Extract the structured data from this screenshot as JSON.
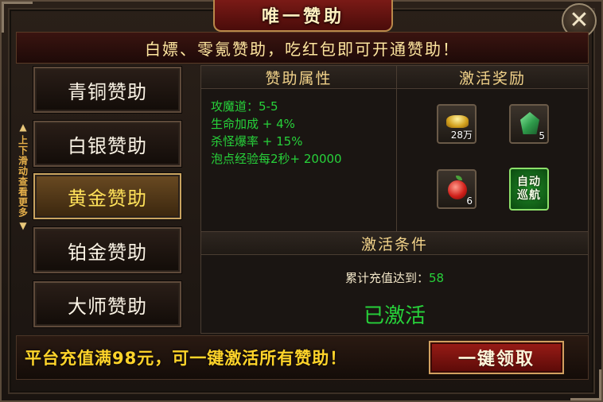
{
  "window": {
    "title": "唯一赞助",
    "close_symbol": "✕",
    "close_icon": "close-icon"
  },
  "banner": {
    "text": "白嫖、零氪赞助，吃红包即可开通赞助！"
  },
  "tiers": {
    "items": [
      {
        "label": "青铜赞助",
        "active": false
      },
      {
        "label": "白银赞助",
        "active": false
      },
      {
        "label": "黄金赞助",
        "active": true
      },
      {
        "label": "铂金赞助",
        "active": false
      },
      {
        "label": "大师赞助",
        "active": false
      }
    ],
    "scroll_hint": "上下滑动查看更多",
    "scroll_up_symbol": "▲",
    "scroll_down_symbol": "▼"
  },
  "attributes": {
    "title": "赞助属性",
    "lines": [
      "攻魔道：5-5",
      "生命加成 + 4%",
      "杀怪爆率 + 15%",
      "泡点经验每2秒+ 20000"
    ]
  },
  "rewards": {
    "title": "激活奖励",
    "items": [
      {
        "icon": "gold-ingot-icon",
        "qty": "28万"
      },
      {
        "icon": "jade-icon",
        "qty": "5"
      },
      {
        "icon": "apple-icon",
        "qty": "6"
      }
    ],
    "auto_cruise": {
      "line1": "自动",
      "line2": "巡航"
    }
  },
  "conditions": {
    "title": "激活条件",
    "label": "累计充值达到：",
    "value": "58",
    "status": "已激活"
  },
  "bottom": {
    "text": "平台充值满98元，可一键激活所有赞助！",
    "claim_label": "一键领取"
  },
  "colors": {
    "accent_gold": "#ffd42a",
    "active_green": "#27d13a",
    "button_red": "#9a1c16"
  }
}
